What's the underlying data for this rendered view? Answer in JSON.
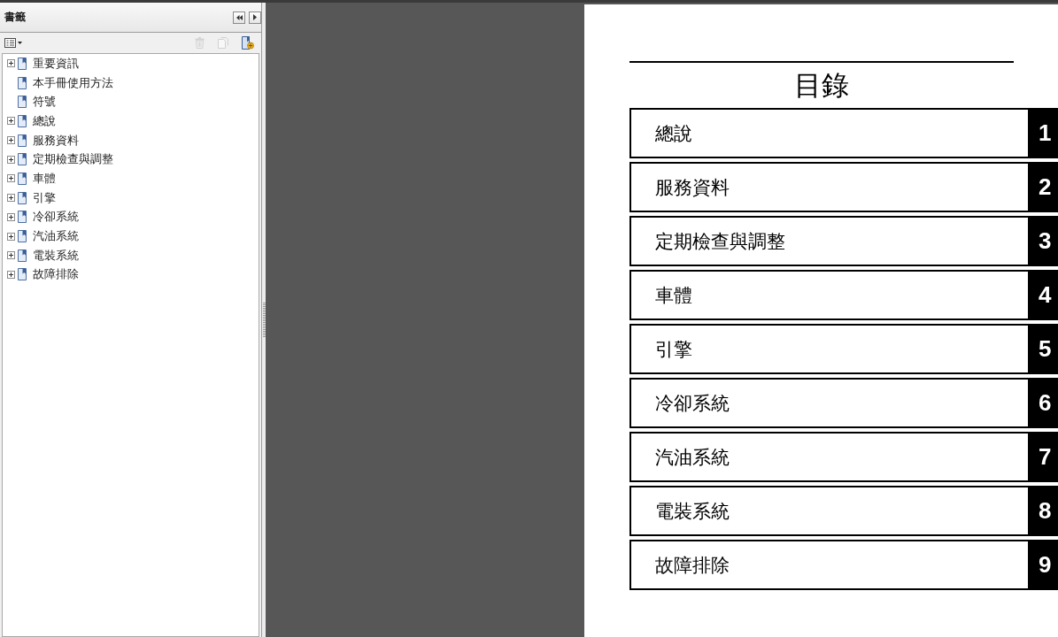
{
  "bookmarks_panel": {
    "title": "書籤",
    "toolbar": [
      {
        "kind": "options",
        "disabled": false
      },
      {
        "kind": "delete",
        "disabled": true
      },
      {
        "kind": "expand",
        "disabled": true
      },
      {
        "kind": "add",
        "disabled": false
      }
    ],
    "items": [
      {
        "label": "重要資訊",
        "kind": "branch",
        "expanded": false
      },
      {
        "label": "本手冊使用方法",
        "kind": "leaf"
      },
      {
        "label": "符號",
        "kind": "leaf"
      },
      {
        "label": "總說",
        "kind": "branch",
        "expanded": false
      },
      {
        "label": "服務資料",
        "kind": "branch",
        "expanded": false
      },
      {
        "label": "定期檢查與調整",
        "kind": "branch",
        "expanded": false
      },
      {
        "label": "車體",
        "kind": "branch",
        "expanded": false
      },
      {
        "label": "引擎",
        "kind": "branch",
        "expanded": false
      },
      {
        "label": "冷卻系統",
        "kind": "branch",
        "expanded": false
      },
      {
        "label": "汽油系統",
        "kind": "branch",
        "expanded": false
      },
      {
        "label": "電裝系統",
        "kind": "branch",
        "expanded": false
      },
      {
        "label": "故障排除",
        "kind": "branch",
        "expanded": false
      }
    ]
  },
  "page": {
    "heading": "目錄",
    "chapters": [
      {
        "title": "總說",
        "number": "1"
      },
      {
        "title": "服務資料",
        "number": "2"
      },
      {
        "title": "定期檢查與調整",
        "number": "3"
      },
      {
        "title": "車體",
        "number": "4"
      },
      {
        "title": "引擎",
        "number": "5"
      },
      {
        "title": "冷卻系統",
        "number": "6"
      },
      {
        "title": "汽油系統",
        "number": "7"
      },
      {
        "title": "電裝系統",
        "number": "8"
      },
      {
        "title": "故障排除",
        "number": "9"
      }
    ]
  }
}
